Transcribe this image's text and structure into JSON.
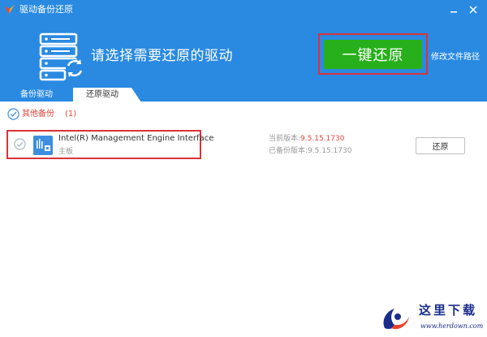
{
  "window": {
    "title": "驱动备份还原",
    "minimize_icon": "minimize-icon",
    "close_icon": "close-icon"
  },
  "header": {
    "prompt": "请选择需要还原的驱动",
    "restore_all_label": "一键还原",
    "edit_path_label": "修改文件路径",
    "hero_icon": "server-restore-icon"
  },
  "tabs": [
    {
      "label": "备份驱动",
      "active": false
    },
    {
      "label": "还原驱动",
      "active": true
    }
  ],
  "group": {
    "label": "其他备份",
    "count": "(1)",
    "checked": true
  },
  "items": [
    {
      "name": "Intel(R) Management Engine Interface",
      "type": "主板",
      "current_version_label": "当前版本:",
      "current_version": "9.5.15.1730",
      "backup_version_label": "已备份版本:",
      "backup_version": "9.5.15.1730",
      "restore_label": "还原",
      "checked": true,
      "icon": "device-chip-icon"
    }
  ],
  "watermark": {
    "title": "这里下载",
    "url": "www.herdown.com"
  },
  "colors": {
    "header_blue": "#2a8ae2",
    "button_green": "#27b01b",
    "highlight_red": "#d8333a",
    "accent_red": "#e0463d",
    "check_blue": "#3a8ee6",
    "watermark_blue": "#1b2d8c"
  }
}
